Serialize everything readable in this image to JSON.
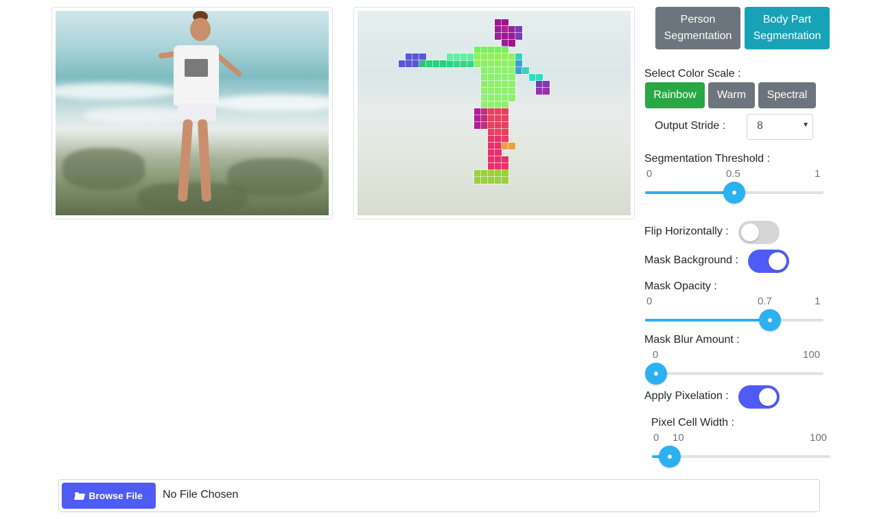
{
  "mode_buttons": {
    "person": "Person\nSegmentation",
    "body_part": "Body Part\nSegmentation"
  },
  "color_scale": {
    "label": "Select Color Scale :",
    "options": [
      "Rainbow",
      "Warm",
      "Spectral"
    ],
    "selected": "Rainbow"
  },
  "output_stride": {
    "label": "Output Stride :",
    "value": "8"
  },
  "segmentation_threshold": {
    "label": "Segmentation Threshold :",
    "min": "0",
    "max": "1",
    "value_label": "0.5",
    "value": 0.5
  },
  "flip_horizontally": {
    "label": "Flip Horizontally :",
    "on": false
  },
  "mask_background": {
    "label": "Mask Background :",
    "on": true
  },
  "mask_opacity": {
    "label": "Mask Opacity :",
    "min": "0",
    "max": "1",
    "value_label": "0.7",
    "value": 0.7
  },
  "mask_blur": {
    "label": "Mask Blur Amount :",
    "min": "0",
    "max": "100",
    "value": 0
  },
  "apply_pixelation": {
    "label": "Apply Pixelation :",
    "on": true
  },
  "pixel_cell_width": {
    "label": "Pixel Cell Width :",
    "min": "0",
    "max": "100",
    "value_label": "10",
    "value": 10
  },
  "file": {
    "button_label": "Browse File",
    "status": "No File Chosen"
  },
  "colors": {
    "teal": "#17a2b8",
    "green": "#28a745",
    "gray": "#6c757d",
    "blue_toggle": "#4f5bf5",
    "slider": "#2bb0f0"
  }
}
